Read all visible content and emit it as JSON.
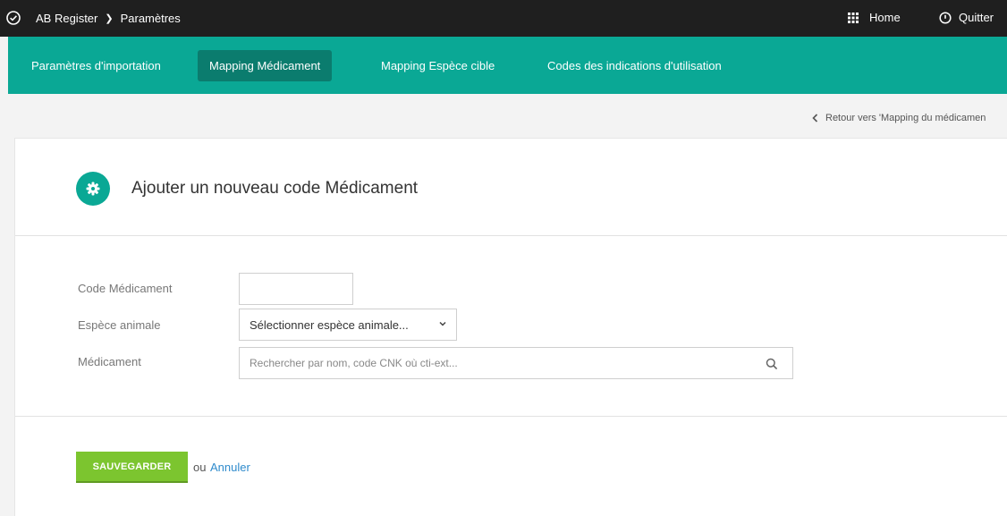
{
  "topbar": {
    "app_name": "AB Register",
    "section": "Paramètres",
    "home_label": "Home",
    "quit_label": "Quitter"
  },
  "nav": {
    "tabs": [
      {
        "label": "Paramètres d'importation",
        "active": false
      },
      {
        "label": "Mapping Médicament",
        "active": true
      },
      {
        "label": "Mapping Espèce cible",
        "active": false
      },
      {
        "label": "Codes des indications d'utilisation",
        "active": false
      }
    ]
  },
  "back_link": "Retour vers 'Mapping du médicamen",
  "form": {
    "title": "Ajouter un nouveau code Médicament",
    "fields": {
      "code_label": "Code Médicament",
      "code_value": "",
      "species_label": "Espèce animale",
      "species_selected": "Sélectionner espèce animale...",
      "drug_label": "Médicament",
      "drug_placeholder": "Rechercher par nom, code CNK où cti-ext..."
    },
    "save_label": "SAUVEGARDER",
    "or_label": "ou",
    "cancel_label": "Annuler"
  },
  "colors": {
    "topbar": "#1f1f1f",
    "accent": "#0aa895",
    "accent_dark": "#0b7c6e",
    "save_green": "#7cc52f",
    "link_blue": "#2f8bcc"
  },
  "icons": [
    "check-circle-icon",
    "chevron-right-icon",
    "grid-icon",
    "power-icon",
    "chevron-left-icon",
    "gear-icon",
    "chevron-down-icon",
    "search-icon"
  ]
}
